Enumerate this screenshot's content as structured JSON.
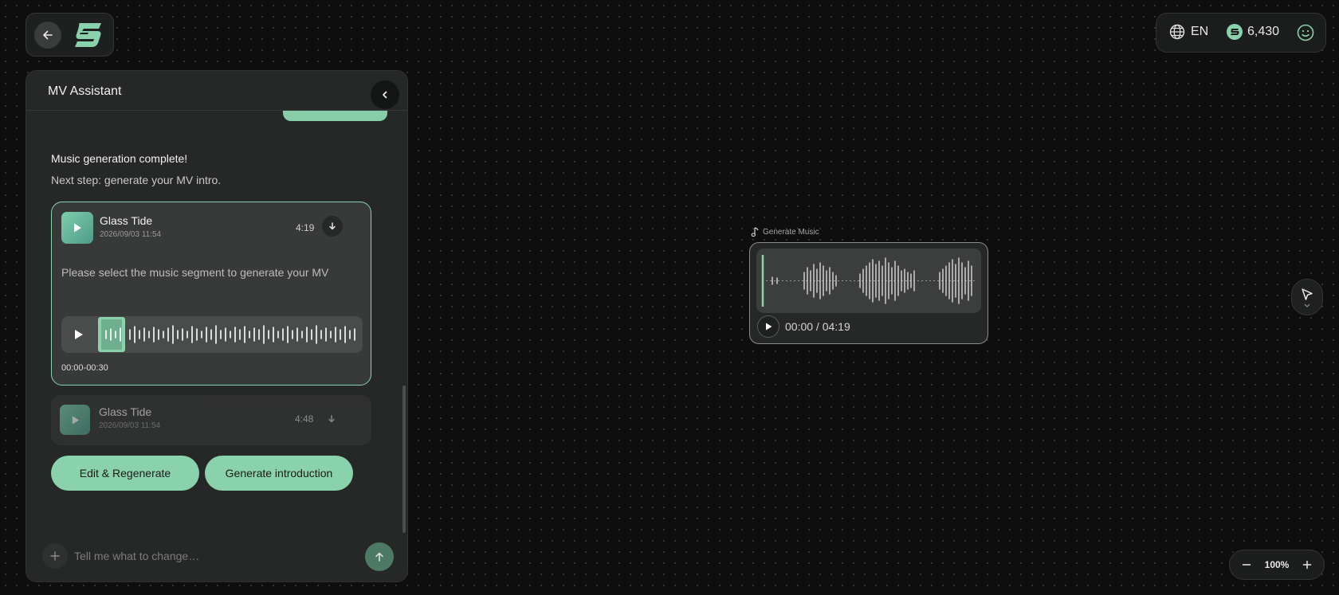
{
  "header": {
    "language": "EN",
    "credits": "6,430"
  },
  "panel": {
    "title": "MV Assistant",
    "message_title": "Music generation complete!",
    "message_body": "Next step: generate your MV intro.",
    "tracks": [
      {
        "title": "Glass Tide",
        "date": "2026/09/03 11:54",
        "duration": "4:19",
        "select_hint": "Please select the music segment to generate your MV",
        "segment_range": "00:00-00:30"
      },
      {
        "title": "Glass Tide",
        "date": "2026/09/03 11:54",
        "duration": "4:48"
      }
    ],
    "edit_button": "Edit & Regenerate",
    "generate_button": "Generate introduction",
    "input_placeholder": "Tell me what to change…"
  },
  "node": {
    "label": "Generate Music",
    "time": "00:00 / 04:19"
  },
  "zoom": {
    "level": "100%"
  },
  "colors": {
    "accent": "#8ad2ab",
    "background": "#0d0e0d",
    "panel": "#262727"
  }
}
